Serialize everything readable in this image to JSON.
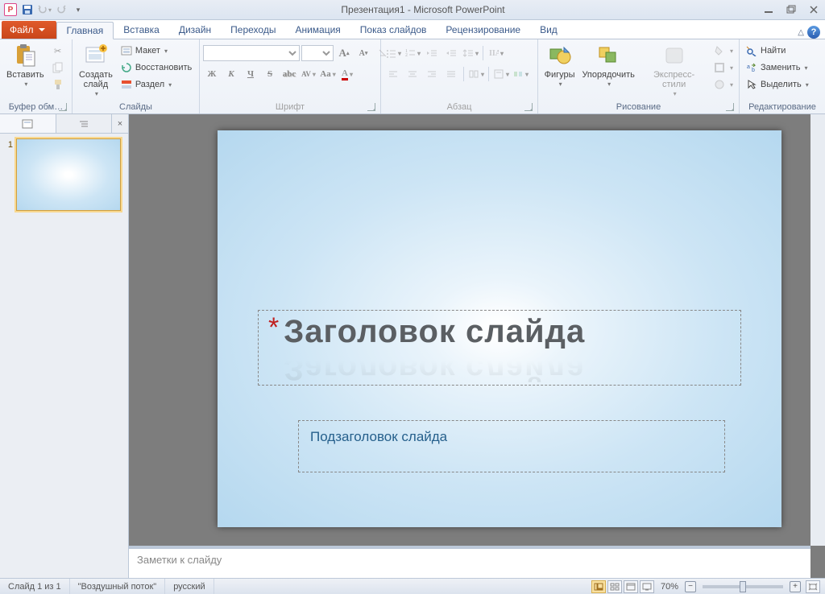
{
  "titlebar": {
    "app_icon_letter": "P",
    "title": "Презентация1 - Microsoft PowerPoint"
  },
  "tabs": {
    "file": "Файл",
    "home": "Главная",
    "insert": "Вставка",
    "design": "Дизайн",
    "transitions": "Переходы",
    "animations": "Анимация",
    "slideshow": "Показ слайдов",
    "review": "Рецензирование",
    "view": "Вид"
  },
  "groups": {
    "clipboard": {
      "label": "Буфер обм…",
      "paste": "Вставить"
    },
    "slides": {
      "label": "Слайды",
      "new": "Создать\nслайд",
      "layout": "Макет",
      "restore": "Восстановить",
      "section": "Раздел"
    },
    "font": {
      "label": "Шрифт"
    },
    "paragraph": {
      "label": "Абзац"
    },
    "drawing": {
      "label": "Рисование",
      "shapes": "Фигуры",
      "arrange": "Упорядочить",
      "quick": "Экспресс-стили"
    },
    "editing": {
      "label": "Редактирование",
      "find": "Найти",
      "replace": "Заменить",
      "select": "Выделить"
    }
  },
  "thumb": {
    "num": "1"
  },
  "slide": {
    "title": "Заголовок слайда",
    "subtitle": "Подзаголовок слайда"
  },
  "notes": {
    "placeholder": "Заметки к слайду"
  },
  "status": {
    "slide": "Слайд 1 из 1",
    "theme": "\"Воздушный поток\"",
    "lang": "русский",
    "zoom": "70%"
  }
}
